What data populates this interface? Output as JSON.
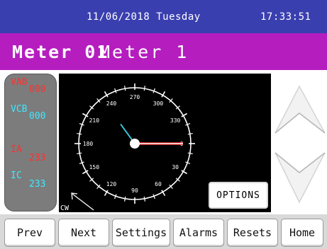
{
  "header": {
    "date": "11/06/2018 Tuesday",
    "time": "17:33:51"
  },
  "title": {
    "meter_id": "Meter 01",
    "meter_name": "Meter 1"
  },
  "channels": [
    {
      "label": "VAB",
      "value": "000",
      "color": "#ff3030"
    },
    {
      "label": "VCB",
      "value": "000",
      "color": "#40e8ff"
    },
    {
      "label": "IA",
      "value": "233",
      "color": "#ff3030"
    },
    {
      "label": "IC",
      "value": "233",
      "color": "#40e8ff"
    }
  ],
  "dial": {
    "degree_labels": [
      "0",
      "30",
      "60",
      "90",
      "120",
      "150",
      "180",
      "210",
      "240",
      "270",
      "300",
      "330"
    ],
    "direction_label": "CW",
    "phasors": [
      {
        "name": "red",
        "angle_deg": 0,
        "color": "#ff2020"
      },
      {
        "name": "white",
        "angle_deg": 0,
        "color": "#ffffff"
      },
      {
        "name": "cyan",
        "angle_deg": 234,
        "color": "#3fd4f0"
      }
    ]
  },
  "options_label": "OPTIONS",
  "arrows": {
    "up": "up-arrow",
    "down": "down-arrow"
  },
  "nav": [
    "Prev",
    "Next",
    "Settings",
    "Alarms",
    "Resets",
    "Home"
  ]
}
